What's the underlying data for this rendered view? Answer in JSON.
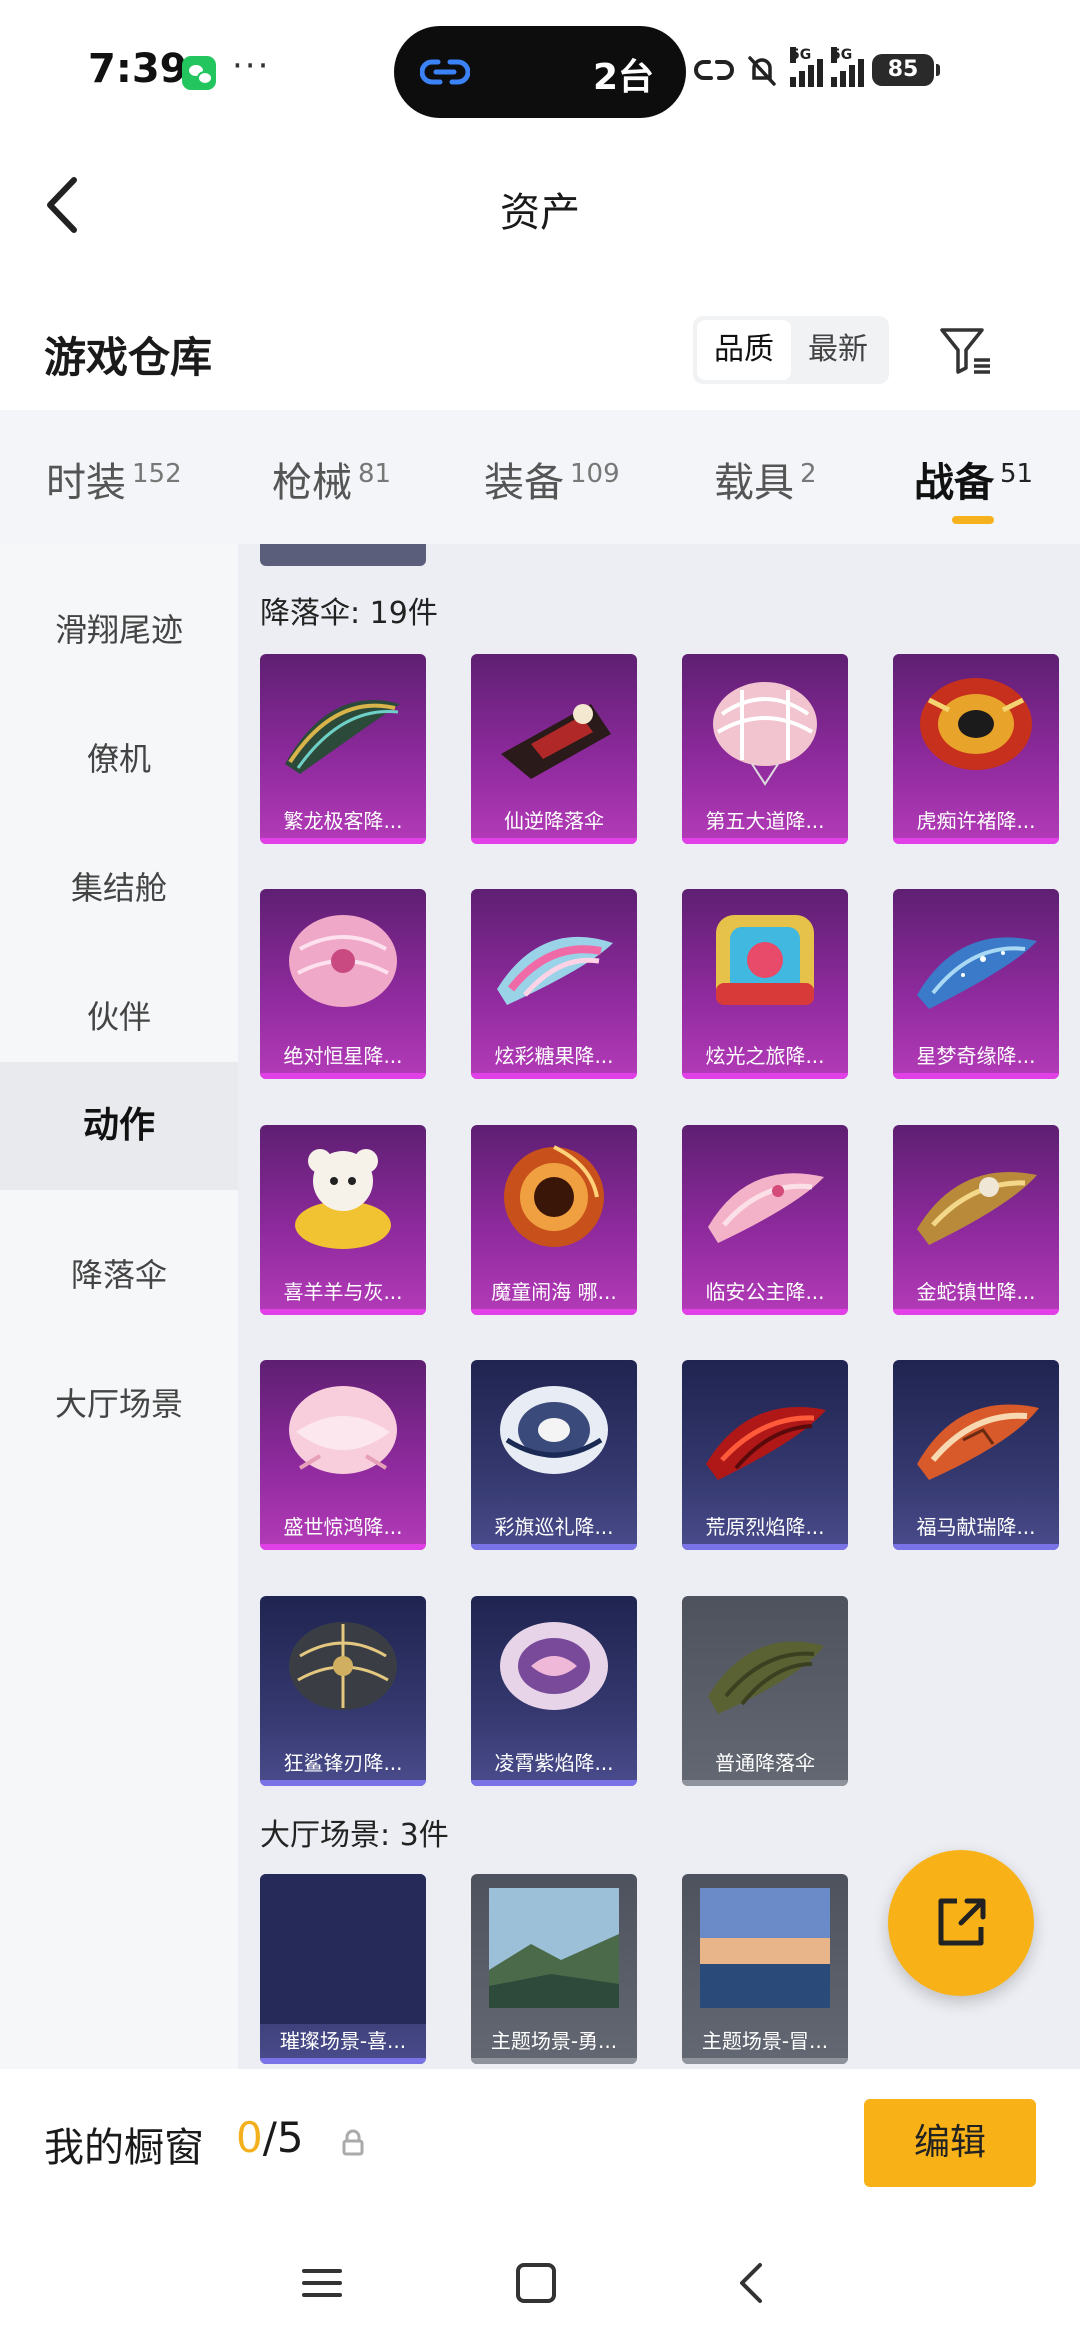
{
  "status_bar": {
    "time": "7:39",
    "more": "···",
    "island_text": "2台",
    "network_label_1": "5G",
    "network_label_2": "5G",
    "battery": "85"
  },
  "header": {
    "title": "资产"
  },
  "warehouse": {
    "title": "游戏仓库",
    "sort_options": [
      "品质",
      "最新"
    ],
    "sort_active": "品质"
  },
  "tabs": [
    {
      "label": "时装",
      "count": "152"
    },
    {
      "label": "枪械",
      "count": "81"
    },
    {
      "label": "装备",
      "count": "109"
    },
    {
      "label": "载具",
      "count": "2"
    },
    {
      "label": "战备",
      "count": "51"
    }
  ],
  "active_tab": "战备",
  "sidebar": {
    "items": [
      "滑翔尾迹",
      "僚机",
      "集结舱",
      "伙伴",
      "动作",
      "降落伞",
      "大厅场景"
    ],
    "active": "动作"
  },
  "sections": {
    "parachute": {
      "title": "降落伞: 19件",
      "items": [
        {
          "label": "繁龙极客降...",
          "rarity": "purple"
        },
        {
          "label": "仙逆降落伞",
          "rarity": "purple"
        },
        {
          "label": "第五大道降...",
          "rarity": "purple"
        },
        {
          "label": "虎痴许褚降...",
          "rarity": "purple"
        },
        {
          "label": "绝对恒星降...",
          "rarity": "purple"
        },
        {
          "label": "炫彩糖果降...",
          "rarity": "purple"
        },
        {
          "label": "炫光之旅降...",
          "rarity": "purple"
        },
        {
          "label": "星梦奇缘降...",
          "rarity": "purple"
        },
        {
          "label": "喜羊羊与灰...",
          "rarity": "purple"
        },
        {
          "label": "魔童闹海 哪...",
          "rarity": "purple"
        },
        {
          "label": "临安公主降...",
          "rarity": "purple"
        },
        {
          "label": "金蛇镇世降...",
          "rarity": "purple"
        },
        {
          "label": "盛世惊鸿降...",
          "rarity": "purple"
        },
        {
          "label": "彩旗巡礼降...",
          "rarity": "blue"
        },
        {
          "label": "荒原烈焰降...",
          "rarity": "blue"
        },
        {
          "label": "福马献瑞降...",
          "rarity": "blue"
        },
        {
          "label": "狂鲨锋刃降...",
          "rarity": "blue"
        },
        {
          "label": "凌霄紫焰降...",
          "rarity": "blue"
        },
        {
          "label": "普通降落伞",
          "rarity": "gray"
        }
      ]
    },
    "lobby": {
      "title": "大厅场景: 3件",
      "items": [
        {
          "label": "璀璨场景-喜...",
          "rarity": "blue"
        },
        {
          "label": "主题场景-勇...",
          "rarity": "gray"
        },
        {
          "label": "主题场景-冒...",
          "rarity": "gray"
        }
      ]
    }
  },
  "bottom_bar": {
    "label": "我的橱窗",
    "count_current": "0",
    "count_total": "/5",
    "edit_label": "编辑"
  },
  "colors": {
    "accent": "#f8b218",
    "rare_purple": "#8e2a9d",
    "rare_blue": "#34386e",
    "common_gray": "#636873"
  }
}
